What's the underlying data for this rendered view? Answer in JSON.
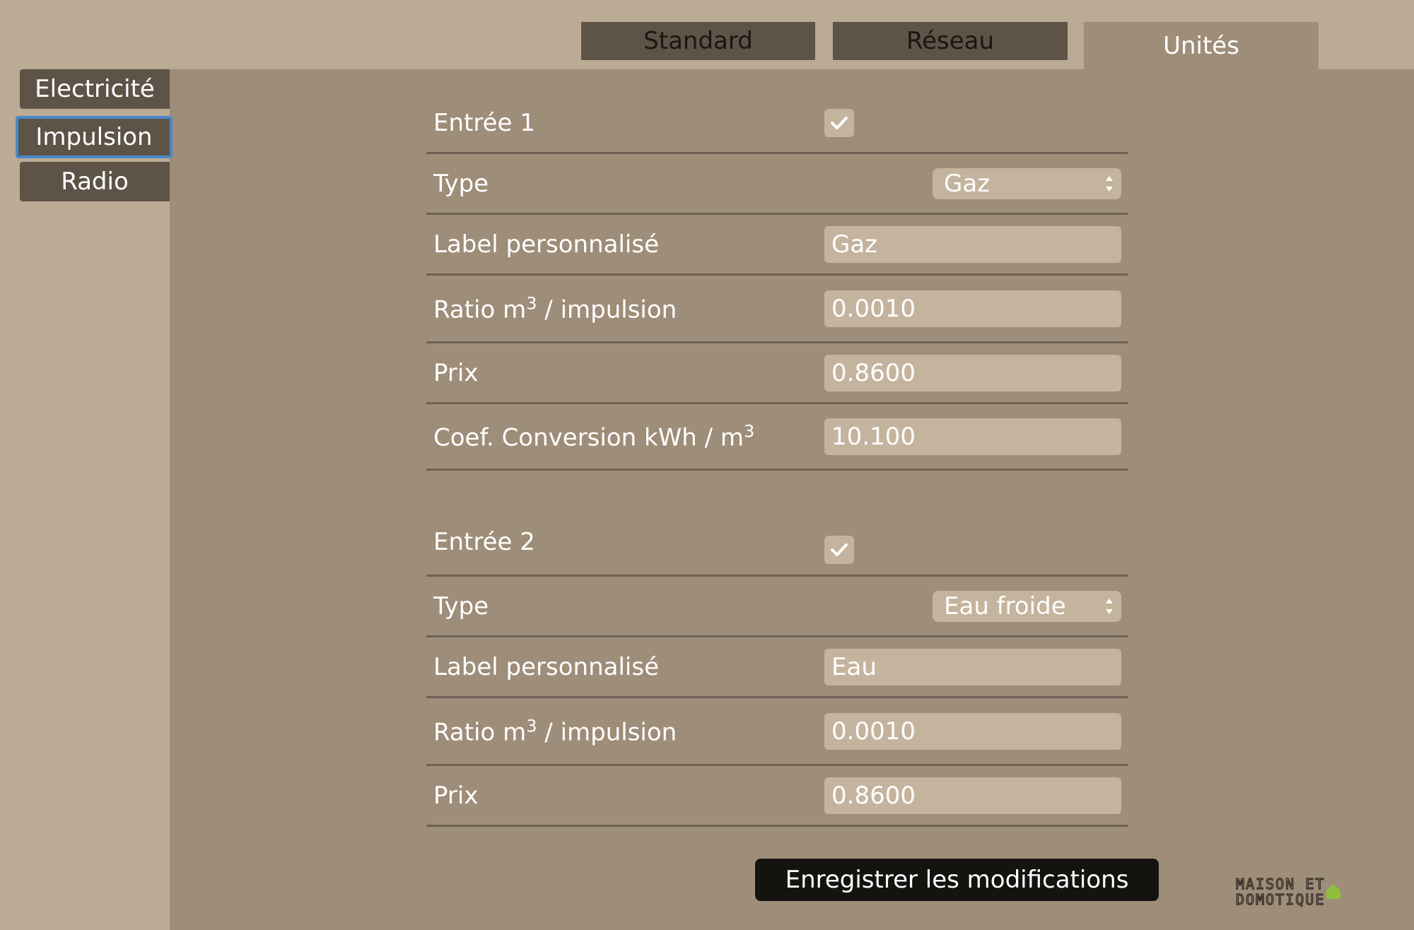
{
  "tabs": {
    "standard": "Standard",
    "reseau": "Réseau",
    "unites": "Unités"
  },
  "sidebar": {
    "items": [
      "Electricité",
      "Impulsion",
      "Radio"
    ]
  },
  "input1": {
    "title": "Entrée 1",
    "enabled": true,
    "type_label": "Type",
    "type_value": "Gaz",
    "custom_label_label": "Label personnalisé",
    "custom_label_value": "Gaz",
    "ratio_label_prefix": "Ratio m",
    "ratio_label_sup": "3",
    "ratio_label_suffix": " / impulsion",
    "ratio_value": "0.0010",
    "price_label": "Prix",
    "price_value": "0.8600",
    "coef_label_prefix": "Coef. Conversion kWh / m",
    "coef_label_sup": "3",
    "coef_value": "10.100"
  },
  "input2": {
    "title": "Entrée 2",
    "enabled": true,
    "type_label": "Type",
    "type_value": "Eau froide",
    "custom_label_label": "Label personnalisé",
    "custom_label_value": "Eau",
    "ratio_label_prefix": "Ratio m",
    "ratio_label_sup": "3",
    "ratio_label_suffix": " / impulsion",
    "ratio_value": "0.0010",
    "price_label": "Prix",
    "price_value": "0.8600"
  },
  "save_button": "Enregistrer les modifications",
  "logo": {
    "line1": "MAISON ET",
    "line2": "DOMOTIQUE"
  },
  "colors": {
    "background": "#bbab95",
    "panel": "#9e8d78",
    "tab_dark": "#5e5347",
    "field": "#c4b49e",
    "focus": "#4a88c8",
    "button": "#151310"
  }
}
